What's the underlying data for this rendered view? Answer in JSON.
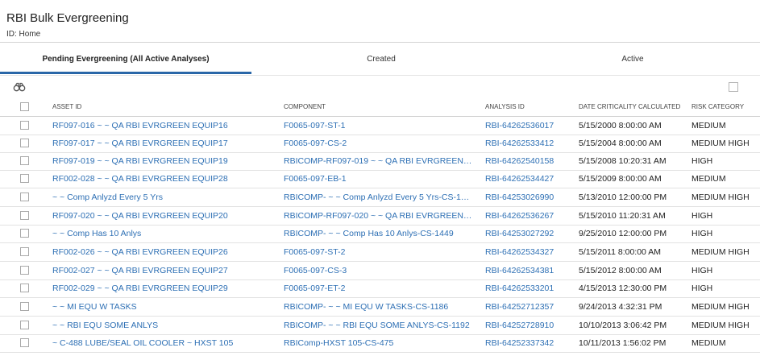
{
  "header": {
    "title": "RBI Bulk Evergreening",
    "subtitle": "ID: Home"
  },
  "tabs": [
    {
      "label": "Pending Evergreening (All Active Analyses)",
      "active": true
    },
    {
      "label": "Created",
      "active": false
    },
    {
      "label": "Active",
      "active": false
    }
  ],
  "toolbar": {
    "search_icon": "binoculars-icon",
    "select_icon": "checkbox-icon"
  },
  "colors": {
    "link": "#2d6fb4",
    "tab_underline": "#2a67a8"
  },
  "grid": {
    "columns": [
      "ASSET ID",
      "COMPONENT",
      "ANALYSIS ID",
      "DATE CRITICALITY CALCULATED",
      "RISK CATEGORY"
    ],
    "rows": [
      {
        "asset": "RF097-016 ~ ~ QA RBI EVRGREEN EQUIP16",
        "component": "F0065-097-ST-1",
        "analysis": "RBI-64262536017",
        "date": "5/15/2000 8:00:00 AM",
        "risk": "MEDIUM"
      },
      {
        "asset": "RF097-017 ~ ~ QA RBI EVRGREEN EQUIP17",
        "component": "F0065-097-CS-2",
        "analysis": "RBI-64262533412",
        "date": "5/15/2004 8:00:00 AM",
        "risk": "MEDIUM HIGH"
      },
      {
        "asset": "RF097-019 ~ ~ QA RBI EVRGREEN EQUIP19",
        "component": "RBICOMP-RF097-019 ~ ~ QA RBI EVRGREEN E...",
        "analysis": "RBI-64262540158",
        "date": "5/15/2008 10:20:31 AM",
        "risk": "HIGH"
      },
      {
        "asset": "RF002-028 ~ ~ QA RBI EVRGREEN EQUIP28",
        "component": "F0065-097-EB-1",
        "analysis": "RBI-64262534427",
        "date": "5/15/2009 8:00:00 AM",
        "risk": "MEDIUM"
      },
      {
        "asset": "~ ~ Comp Anlyzd Every 5 Yrs",
        "component": "RBICOMP- ~ ~ Comp Anlyzd Every 5 Yrs-CS-14...",
        "analysis": "RBI-64253026990",
        "date": "5/13/2010 12:00:00 PM",
        "risk": "MEDIUM HIGH"
      },
      {
        "asset": "RF097-020 ~ ~ QA RBI EVRGREEN EQUIP20",
        "component": "RBICOMP-RF097-020 ~ ~ QA RBI EVRGREEN E...",
        "analysis": "RBI-64262536267",
        "date": "5/15/2010 11:20:31 AM",
        "risk": "HIGH"
      },
      {
        "asset": "~ ~ Comp Has 10 Anlys",
        "component": "RBICOMP- ~ ~ Comp Has 10 Anlys-CS-1449",
        "analysis": "RBI-64253027292",
        "date": "9/25/2010 12:00:00 PM",
        "risk": "HIGH"
      },
      {
        "asset": "RF002-026 ~ ~ QA RBI EVRGREEN EQUIP26",
        "component": "F0065-097-ST-2",
        "analysis": "RBI-64262534327",
        "date": "5/15/2011 8:00:00 AM",
        "risk": "MEDIUM HIGH"
      },
      {
        "asset": "RF002-027 ~ ~ QA RBI EVRGREEN EQUIP27",
        "component": "F0065-097-CS-3",
        "analysis": "RBI-64262534381",
        "date": "5/15/2012 8:00:00 AM",
        "risk": "HIGH"
      },
      {
        "asset": "RF002-029 ~ ~ QA RBI EVRGREEN EQUIP29",
        "component": "F0065-097-ET-2",
        "analysis": "RBI-64262533201",
        "date": "4/15/2013 12:30:00 PM",
        "risk": "HIGH"
      },
      {
        "asset": "~ ~ MI EQU W TASKS",
        "component": "RBICOMP- ~ ~ MI EQU W TASKS-CS-1186",
        "analysis": "RBI-64252712357",
        "date": "9/24/2013 4:32:31 PM",
        "risk": "MEDIUM HIGH"
      },
      {
        "asset": "~ ~ RBI EQU SOME ANLYS",
        "component": "RBICOMP- ~ ~ RBI EQU SOME ANLYS-CS-1192",
        "analysis": "RBI-64252728910",
        "date": "10/10/2013 3:06:42 PM",
        "risk": "MEDIUM HIGH"
      },
      {
        "asset": "~ C-488 LUBE/SEAL OIL COOLER ~ HXST 105",
        "component": "RBIComp-HXST 105-CS-475",
        "analysis": "RBI-64252337342",
        "date": "10/11/2013 1:56:02 PM",
        "risk": "MEDIUM"
      }
    ]
  }
}
